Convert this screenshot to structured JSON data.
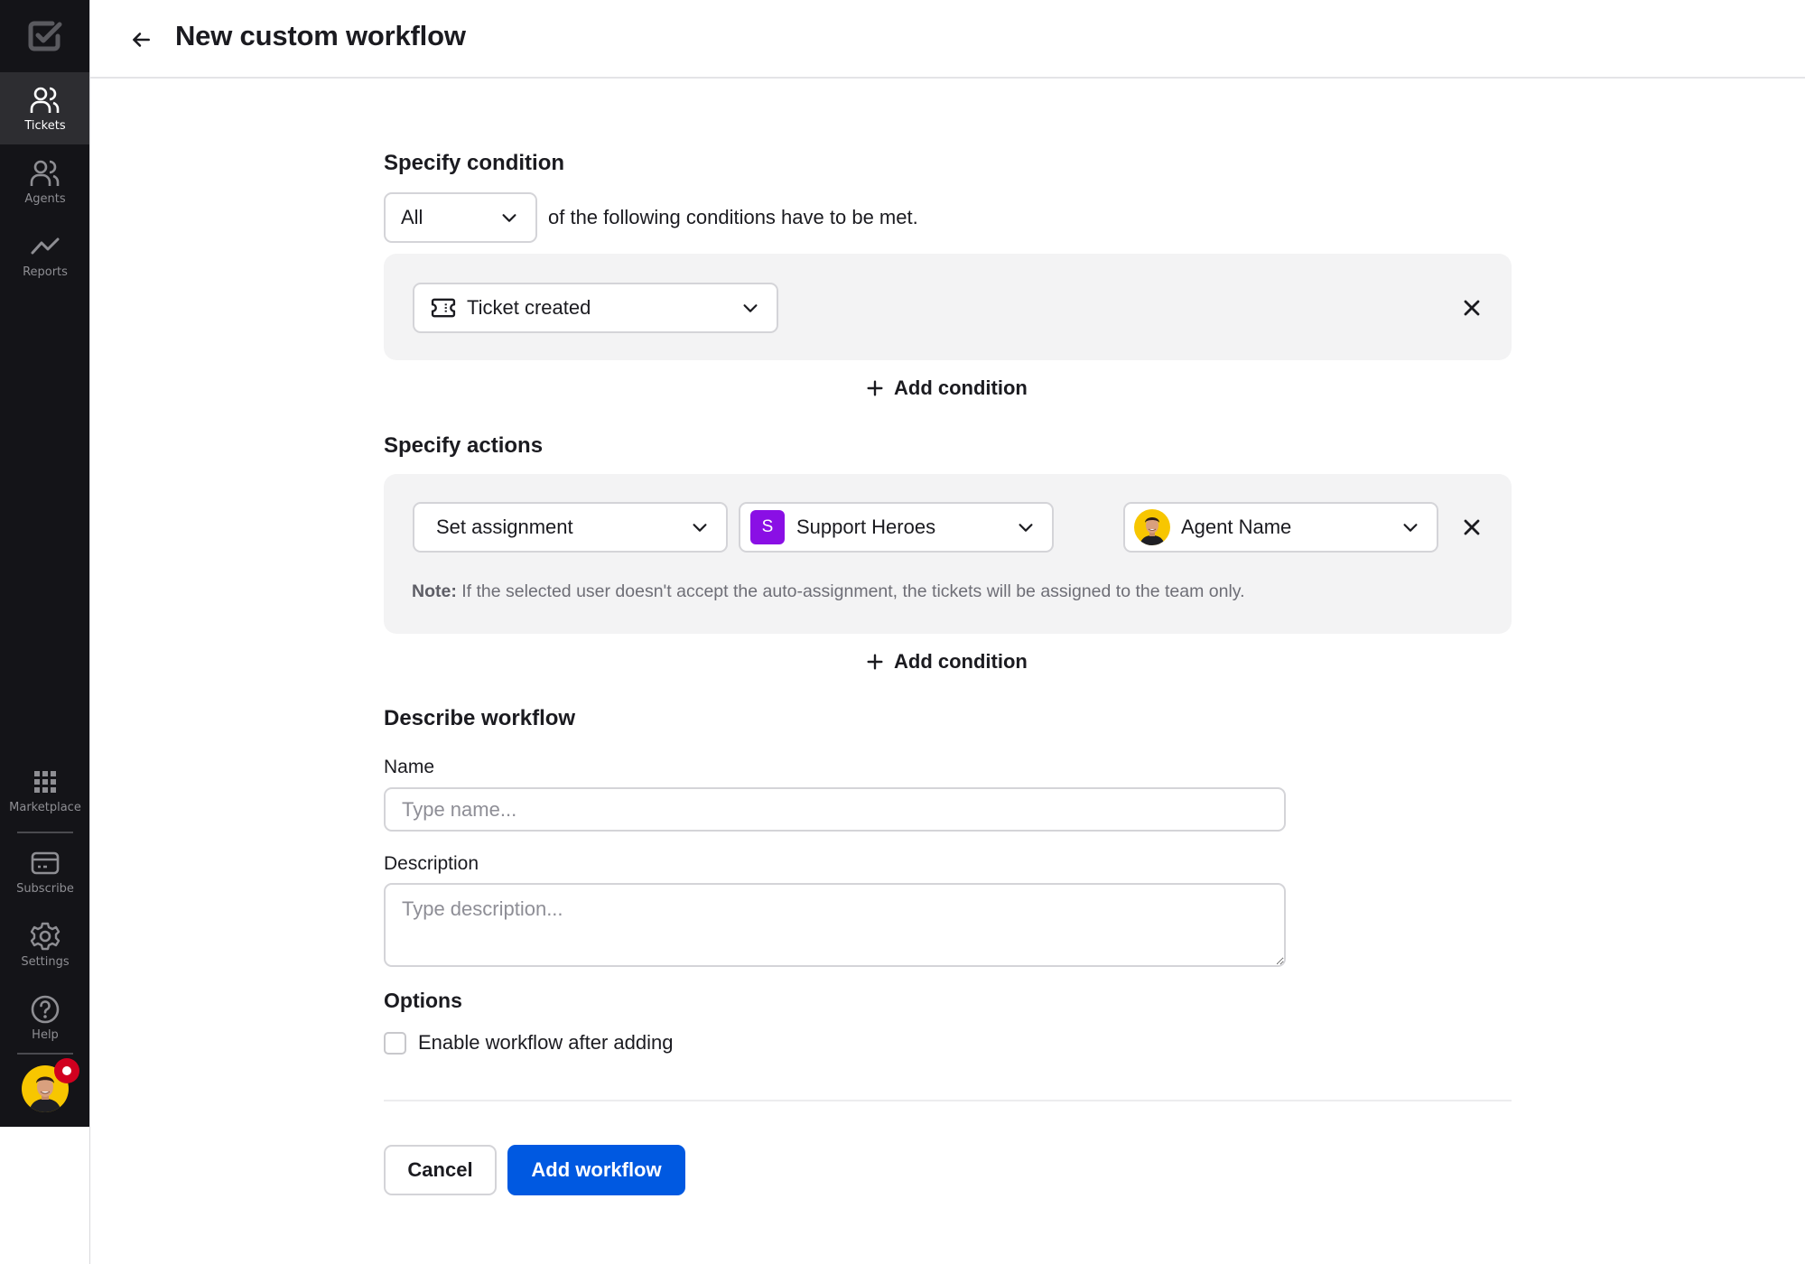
{
  "sidebar": {
    "logo_icon": "checkbox-logo-icon",
    "top_items": [
      {
        "label": "Tickets",
        "icon": "users-icon",
        "active": true
      },
      {
        "label": "Agents",
        "icon": "users-icon",
        "active": false
      },
      {
        "label": "Reports",
        "icon": "trend-line-icon",
        "active": false
      }
    ],
    "bottom_items": [
      {
        "label": "Marketplace",
        "icon": "grid-icon"
      },
      {
        "label": "Subscribe",
        "icon": "credit-card-icon"
      },
      {
        "label": "Settings",
        "icon": "gear-icon"
      },
      {
        "label": "Help",
        "icon": "help-circle-icon"
      }
    ],
    "user_avatar": {
      "icon": "user-avatar",
      "status_badge": "notification-badge"
    }
  },
  "header": {
    "back_icon": "arrow-left-icon",
    "title": "New custom workflow"
  },
  "condition": {
    "title": "Specify condition",
    "match_select": {
      "value": "All"
    },
    "match_text": "of the following conditions have to be met.",
    "items": [
      {
        "icon": "ticket-icon",
        "value": "Ticket created"
      }
    ],
    "add_label": "Add condition"
  },
  "actions": {
    "title": "Specify actions",
    "items": [
      {
        "action": "Set assignment",
        "team": {
          "initial": "S",
          "name": "Support Heroes",
          "color": "#8a0fe5"
        },
        "agent": {
          "name": "Agent Name"
        }
      }
    ],
    "note_label": "Note:",
    "note_text": " If the selected user doesn't accept the auto-assignment, the tickets will be assigned to the team only.",
    "add_label": "Add condition"
  },
  "describe": {
    "title": "Describe workflow",
    "name_label": "Name",
    "name_placeholder": "Type name...",
    "name_value": "",
    "description_label": "Description",
    "description_placeholder": "Type description...",
    "description_value": ""
  },
  "options": {
    "title": "Options",
    "enable_label": "Enable workflow after adding",
    "enable_checked": false
  },
  "footer": {
    "cancel_label": "Cancel",
    "submit_label": "Add workflow"
  },
  "colors": {
    "primary": "#0059e1",
    "sidebar_bg": "#141418",
    "sidebar_active": "#2d2d31",
    "panel_bg": "#f3f3f4",
    "team_badge": "#8a0fe5",
    "notification": "#d1001f"
  }
}
